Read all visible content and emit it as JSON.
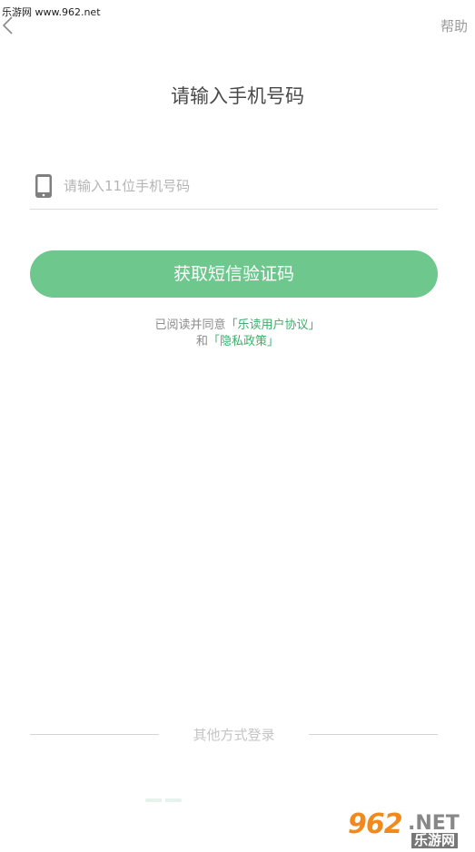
{
  "watermark": {
    "site_text": "乐游网 www.962.net"
  },
  "header": {
    "back_icon": "chevron-left-icon",
    "help_label": "帮助"
  },
  "main": {
    "title": "请输入手机号码",
    "phone_input": {
      "icon": "phone-icon",
      "value": "",
      "placeholder": "请输入11位手机号码"
    },
    "sms_button_label": "获取短信验证码",
    "agreement": {
      "prefix": "已阅读并同意",
      "open_bracket": "「",
      "close_bracket": "」",
      "user_agreement_link": "乐读用户协议",
      "conjunction": "和",
      "privacy_link": "隐私政策"
    }
  },
  "footer": {
    "other_login_label": "其他方式登录"
  },
  "brand": {
    "logo_number": "962",
    "logo_suffix": ".NET",
    "logo_cn": "乐游网"
  },
  "colors": {
    "accent_green": "#6ec78d",
    "link_green": "#3fae6a",
    "brand_orange": "#f08a1c"
  }
}
